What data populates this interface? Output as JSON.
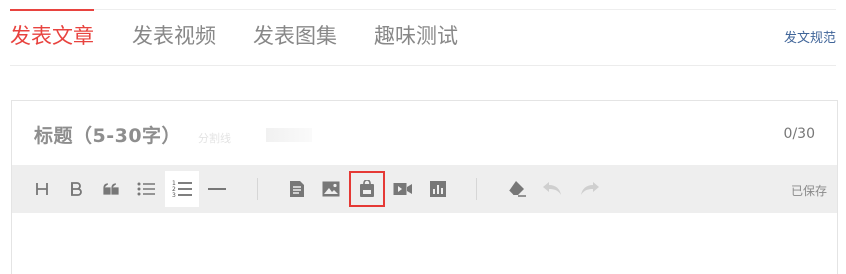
{
  "tabs": [
    {
      "label": "发表文章",
      "active": true
    },
    {
      "label": "发表视频",
      "active": false
    },
    {
      "label": "发表图集",
      "active": false
    },
    {
      "label": "趣味测试",
      "active": false
    }
  ],
  "rules_link": "发文规范",
  "editor": {
    "title_placeholder": "标题（5-30字）",
    "faint_text": "分割线",
    "char_count": "0/30"
  },
  "toolbar": {
    "buttons": [
      {
        "icon": "heading-icon",
        "glyph": "H"
      },
      {
        "icon": "bold-icon",
        "glyph": "B"
      },
      {
        "icon": "quote-icon"
      },
      {
        "icon": "bullet-list-icon"
      },
      {
        "icon": "numbered-list-icon",
        "selected": true
      },
      {
        "icon": "divider-icon"
      },
      {
        "icon": "document-icon"
      },
      {
        "icon": "image-icon"
      },
      {
        "icon": "bag-icon",
        "highlighted": true
      },
      {
        "icon": "video-icon"
      },
      {
        "icon": "chart-icon"
      },
      {
        "icon": "eraser-icon"
      },
      {
        "icon": "undo-icon",
        "disabled": true
      },
      {
        "icon": "redo-icon",
        "disabled": true
      }
    ],
    "status": "已保存"
  },
  "colors": {
    "accent": "#e8433f",
    "link": "#406599",
    "highlight_border": "#e53935",
    "toolbar_bg": "#eeeeee"
  }
}
